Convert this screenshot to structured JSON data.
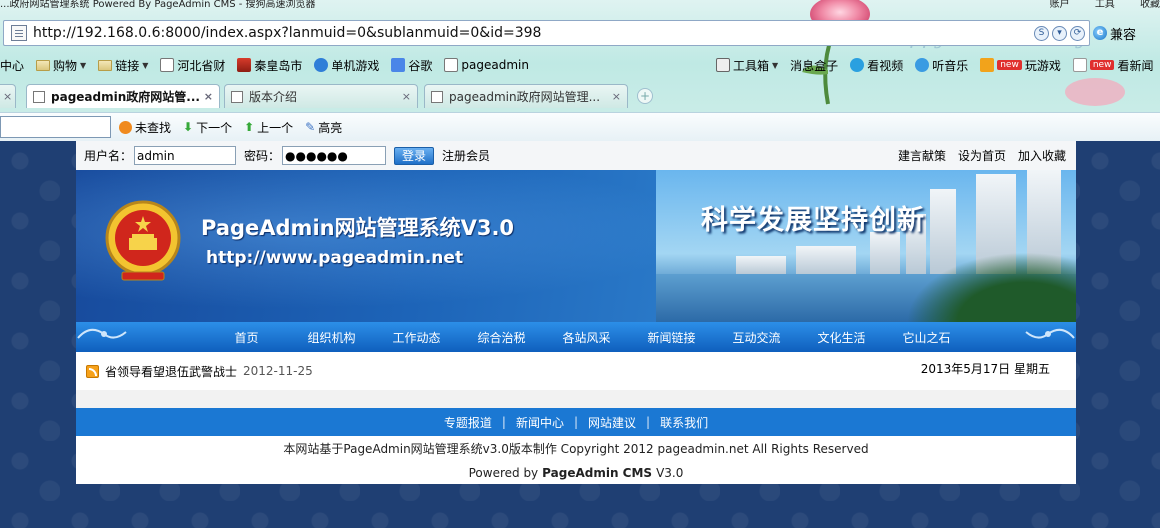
{
  "browser": {
    "window_title": "...政府网站管理系统 Powered By PageAdmin CMS - 搜狗高速浏览器",
    "menus": [
      "账户",
      "工具",
      "收藏"
    ],
    "url": "http://192.168.0.6:8000/index.aspx?lanmuid=0&sublanmuid=0&id=398",
    "compat_label": "兼容",
    "deco_text": "Happy mother's Day",
    "bookmarks": [
      {
        "label": "中心",
        "icon": "none"
      },
      {
        "label": "购物",
        "icon": "folder-icon",
        "dropdown": true
      },
      {
        "label": "链接",
        "icon": "folder-icon",
        "dropdown": true
      },
      {
        "label": "河北省财",
        "icon": "page-icon"
      },
      {
        "label": "秦皇岛市",
        "icon": "page-icon"
      },
      {
        "label": "单机游戏",
        "icon": "game-icon"
      },
      {
        "label": "谷歌",
        "icon": "google-icon"
      },
      {
        "label": "pageadmin",
        "icon": "page-icon"
      }
    ],
    "toolbar_right": [
      {
        "label": "工具箱",
        "dropdown": true
      },
      {
        "label": "消息盒子"
      },
      {
        "label": "看视频"
      },
      {
        "label": "听音乐"
      },
      {
        "label": "玩游戏",
        "badge": "new"
      },
      {
        "label": "看新闻",
        "badge": "new"
      }
    ],
    "tabs": [
      {
        "label": "pageadmin政府网站管...",
        "active": true
      },
      {
        "label": "版本介绍",
        "active": false
      },
      {
        "label": "pageadmin政府网站管理...",
        "active": false
      }
    ],
    "find": {
      "not_found": "未查找",
      "next": "下一个",
      "prev": "上一个",
      "highlight": "高亮"
    }
  },
  "page": {
    "login": {
      "username_label": "用户名：",
      "username_value": "admin",
      "password_label": "密码：",
      "password_value": "●●●●●●",
      "login_button": "登录",
      "register_link": "注册会员",
      "links": [
        "建言献策",
        "设为首页",
        "加入收藏"
      ]
    },
    "banner": {
      "title": "PageAdmin网站管理系统V3.0",
      "url": "http://www.pageadmin.net",
      "slogan": "科学发展坚持创新"
    },
    "nav": [
      "首页",
      "组织机构",
      "工作动态",
      "综合治税",
      "各站风采",
      "新闻链接",
      "互动交流",
      "文化生活",
      "它山之石"
    ],
    "news": {
      "title": "省领导看望退伍武警战士",
      "date": "2012-11-25"
    },
    "today": "2013年5月17日  星期五",
    "footer": {
      "links": [
        "专题报道",
        "新闻中心",
        "网站建议",
        "联系我们"
      ],
      "separator": "|",
      "copyright": "本网站基于PageAdmin网站管理系统v3.0版本制作  Copyright 2012  pageadmin.net All Rights Reserved",
      "powered_prefix": "Powered by",
      "powered_brand": "PageAdmin CMS",
      "powered_version": "V3.0"
    }
  },
  "colors": {
    "accent": "#1b78d3",
    "nav": "#1468c6",
    "page_bg": "#1f3f73",
    "badge_new": "#e0302e"
  }
}
